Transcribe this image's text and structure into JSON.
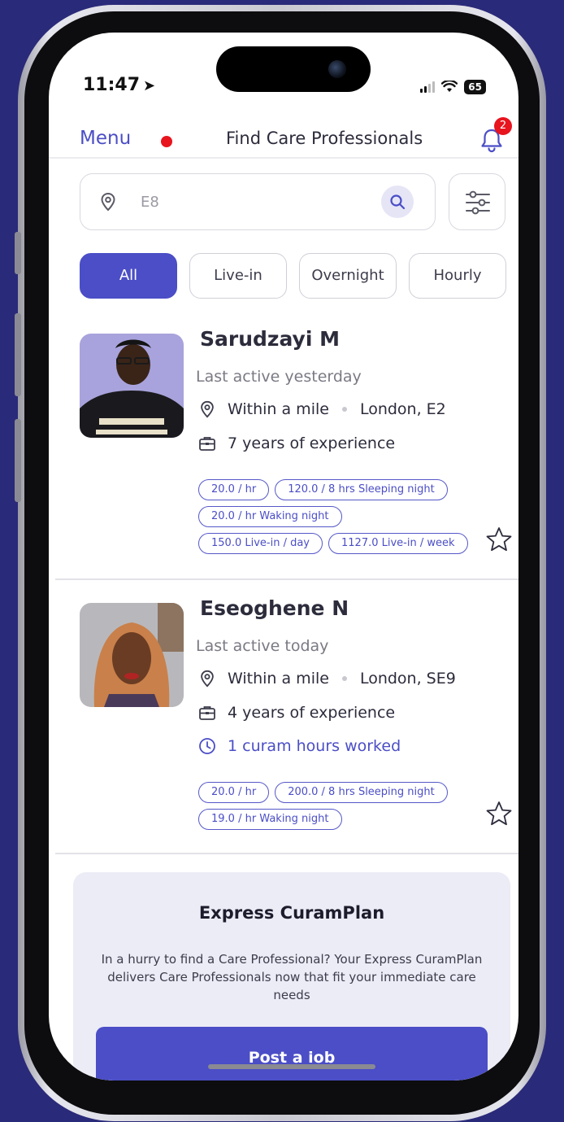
{
  "status_bar": {
    "time": "11:47",
    "battery": "65"
  },
  "nav": {
    "menu_label": "Menu",
    "title": "Find Care Professionals",
    "notification_count": "2"
  },
  "search": {
    "value": "E8"
  },
  "tabs": [
    {
      "label": "All",
      "active": true
    },
    {
      "label": "Live-in",
      "active": false
    },
    {
      "label": "Overnight",
      "active": false
    },
    {
      "label": "Hourly",
      "active": false
    }
  ],
  "professionals": [
    {
      "name": "Sarudzayi M",
      "last_active": "Last active yesterday",
      "distance": "Within a mile",
      "location": "London, E2",
      "experience": "7 years of experience",
      "rates": [
        [
          "20.0 / hr",
          "120.0 / 8 hrs Sleeping night"
        ],
        [
          "20.0 / hr Waking night"
        ],
        [
          "150.0 Live-in / day",
          "1127.0 Live-in / week"
        ]
      ]
    },
    {
      "name": "Eseoghene N",
      "last_active": "Last active today",
      "distance": "Within a mile",
      "location": "London, SE9",
      "experience": "4 years of experience",
      "hours_worked": "1 curam hours worked",
      "rates": [
        [
          "20.0 / hr",
          "200.0 / 8 hrs Sleeping night"
        ],
        [
          "19.0 / hr Waking night"
        ]
      ]
    }
  ],
  "express": {
    "title": "Express CuramPlan",
    "body": "In a hurry to find a Care Professional? Your Express CuramPlan delivers Care Professionals now that fit your immediate care needs",
    "button_label": "Post a iob"
  },
  "colors": {
    "accent": "#4b4ec6",
    "badge_red": "#e8141e",
    "background": "#2a2a7a"
  }
}
